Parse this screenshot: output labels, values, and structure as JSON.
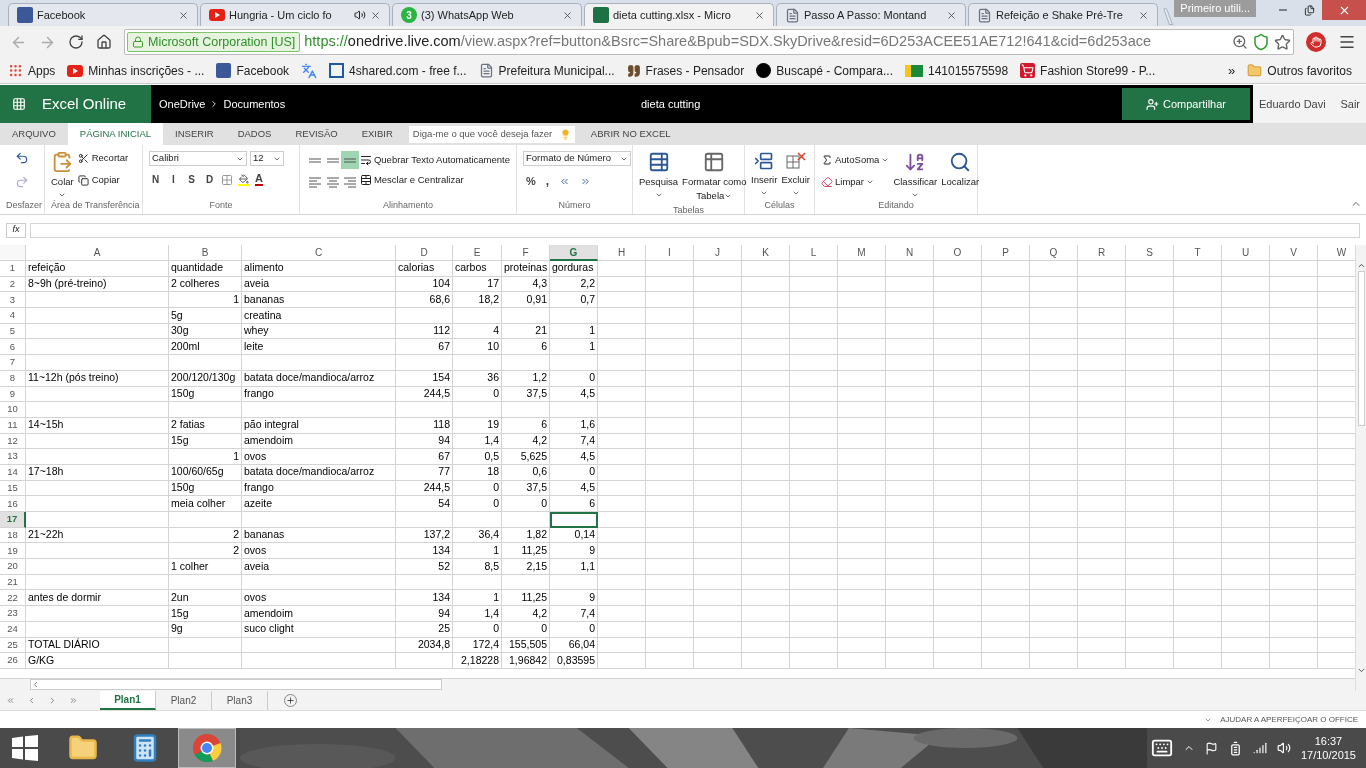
{
  "browser": {
    "tabs": [
      {
        "title": "Facebook",
        "kind": "facebook",
        "selected": false,
        "audio": false
      },
      {
        "title": "Hungria - Um ciclo fo",
        "kind": "youtube",
        "selected": false,
        "audio": true
      },
      {
        "title": "(3) WhatsApp Web",
        "kind": "whatsapp",
        "badge": "3",
        "selected": false,
        "audio": false
      },
      {
        "title": "dieta cutting.xlsx - Micro",
        "kind": "excel",
        "selected": true,
        "audio": false
      },
      {
        "title": "Passo A Passo: Montand",
        "kind": "page",
        "selected": false,
        "audio": false
      },
      {
        "title": "Refeição e Shake Pré-Tre",
        "kind": "page",
        "selected": false,
        "audio": false
      }
    ],
    "profile": "Primeiro utili...",
    "address": {
      "identity": "Microsoft Corporation [US]",
      "scheme": "https://",
      "host": "onedrive.live.com",
      "path": "/view.aspx?ref=button&Bsrc=Share&Bpub=SDX.SkyDrive&resid=6D253ACEE51AE712!641&cid=6d253ace"
    },
    "bookmarks": [
      {
        "title": "Apps",
        "kind": "apps"
      },
      {
        "title": "Minhas inscrições - ...",
        "kind": "youtube"
      },
      {
        "title": "Facebook",
        "kind": "facebook"
      },
      {
        "kind": "translate"
      },
      {
        "title": "4shared.com - free f...",
        "kind": "fourshared"
      },
      {
        "title": "Prefeitura Municipal...",
        "kind": "page"
      },
      {
        "title": "Frases - Pensador",
        "kind": "quote"
      },
      {
        "title": "Buscapé - Compara...",
        "kind": "buscape"
      },
      {
        "title": "141015575598",
        "kind": "flag"
      },
      {
        "title": "Fashion Store99 - P...",
        "kind": "cart"
      }
    ],
    "more": "»",
    "other_bookmarks": "Outros favoritos"
  },
  "excel": {
    "app_name": "Excel Online",
    "breadcrumb": [
      "OneDrive",
      "Documentos"
    ],
    "document_title": "dieta cutting",
    "share": "Compartilhar",
    "user": "Eduardo Davi",
    "sign_out": "Sair",
    "ribbon_tabs": [
      {
        "label": "ARQUIVO",
        "selected": false
      },
      {
        "label": "PÁGINA INICIAL",
        "selected": true
      },
      {
        "label": "INSERIR",
        "selected": false
      },
      {
        "label": "DADOS",
        "selected": false
      },
      {
        "label": "REVISÃO",
        "selected": false
      },
      {
        "label": "EXIBIR",
        "selected": false
      }
    ],
    "tell_me": {
      "placeholder": "Diga-me o que você deseja fazer"
    },
    "open_in_excel": "ABRIR NO EXCEL",
    "ribbon": {
      "undo_group": "Desfazer",
      "clipboard": {
        "label": "Área de Transferência",
        "paste": "Colar",
        "cut": "Recortar",
        "copy": "Copiar"
      },
      "font": {
        "label": "Fonte",
        "family": "Calibri",
        "size": "12",
        "styles": [
          "N",
          "I",
          "S",
          "D"
        ],
        "color_letter": "A"
      },
      "alignment": {
        "label": "Alinhamento",
        "buttons": [
          {
            "kind": "top",
            "selected": false
          },
          {
            "kind": "middle",
            "selected": false
          },
          {
            "kind": "bottom",
            "selected": true
          },
          {
            "kind": "left",
            "selected": false
          },
          {
            "kind": "center",
            "selected": false
          },
          {
            "kind": "right",
            "selected": false
          }
        ],
        "wrap": "Quebrar Texto Automaticamente",
        "merge": "Mesclar e Centralizar"
      },
      "number": {
        "label": "Número",
        "format": "Formato de Número",
        "percent": "%",
        "comma": ","
      },
      "tables": {
        "label": "Tabelas",
        "lookup": "Pesquisa",
        "format_table": "Formatar como",
        "format_table_2": "Tabela"
      },
      "cells": {
        "label": "Células",
        "insert": "Inserir",
        "delete": "Excluir"
      },
      "editing": {
        "label": "Editando",
        "autosum": "AutoSoma",
        "clear": "Limpar",
        "sort": "Classificar",
        "find": "Localizar"
      }
    },
    "formula_bar": {
      "label": "fx"
    },
    "columns": [
      {
        "letter": "A",
        "selected": false
      },
      {
        "letter": "B",
        "selected": false
      },
      {
        "letter": "C",
        "selected": false
      },
      {
        "letter": "D",
        "selected": false
      },
      {
        "letter": "E",
        "selected": false
      },
      {
        "letter": "F",
        "selected": false
      },
      {
        "letter": "G",
        "selected": true
      },
      {
        "letter": "H",
        "selected": false
      },
      {
        "letter": "I",
        "selected": false
      },
      {
        "letter": "J",
        "selected": false
      },
      {
        "letter": "K",
        "selected": false
      },
      {
        "letter": "L",
        "selected": false
      },
      {
        "letter": "M",
        "selected": false
      },
      {
        "letter": "N",
        "selected": false
      },
      {
        "letter": "O",
        "selected": false
      },
      {
        "letter": "P",
        "selected": false
      },
      {
        "letter": "Q",
        "selected": false
      },
      {
        "letter": "R",
        "selected": false
      },
      {
        "letter": "S",
        "selected": false
      },
      {
        "letter": "T",
        "selected": false
      },
      {
        "letter": "U",
        "selected": false
      },
      {
        "letter": "V",
        "selected": false
      },
      {
        "letter": "W",
        "selected": false
      }
    ],
    "rows": [
      {
        "number": "1",
        "selected": false,
        "cells": [
          {
            "text": "refeição",
            "kind": "text"
          },
          {
            "text": "quantidade",
            "kind": "text"
          },
          {
            "text": "alimento",
            "kind": "text"
          },
          {
            "text": "calorias",
            "kind": "text"
          },
          {
            "text": "carbos",
            "kind": "text"
          },
          {
            "text": "proteinas",
            "kind": "text"
          },
          {
            "text": "gorduras",
            "kind": "text"
          }
        ]
      },
      {
        "number": "2",
        "selected": false,
        "cells": [
          {
            "text": "8~9h (pré-treino)",
            "kind": "text"
          },
          {
            "text": "2 colheres",
            "kind": "text"
          },
          {
            "text": "aveia",
            "kind": "text"
          },
          {
            "text": "104",
            "kind": "number"
          },
          {
            "text": "17",
            "kind": "number"
          },
          {
            "text": "4,3",
            "kind": "number"
          },
          {
            "text": "2,2",
            "kind": "number"
          }
        ]
      },
      {
        "number": "3",
        "selected": false,
        "cells": [
          {
            "kind": "empty"
          },
          {
            "text": "1",
            "kind": "number"
          },
          {
            "text": "bananas",
            "kind": "text"
          },
          {
            "text": "68,6",
            "kind": "number"
          },
          {
            "text": "18,2",
            "kind": "number"
          },
          {
            "text": "0,91",
            "kind": "number"
          },
          {
            "text": "0,7",
            "kind": "number"
          }
        ]
      },
      {
        "number": "4",
        "selected": false,
        "cells": [
          {
            "kind": "empty"
          },
          {
            "text": "5g",
            "kind": "text"
          },
          {
            "text": "creatina",
            "kind": "text"
          }
        ]
      },
      {
        "number": "5",
        "selected": false,
        "cells": [
          {
            "kind": "empty"
          },
          {
            "text": "30g",
            "kind": "text"
          },
          {
            "text": "whey",
            "kind": "text"
          },
          {
            "text": "112",
            "kind": "number"
          },
          {
            "text": "4",
            "kind": "number"
          },
          {
            "text": "21",
            "kind": "number"
          },
          {
            "text": "1",
            "kind": "number"
          }
        ]
      },
      {
        "number": "6",
        "selected": false,
        "cells": [
          {
            "kind": "empty"
          },
          {
            "text": "200ml",
            "kind": "text"
          },
          {
            "text": "leite",
            "kind": "text"
          },
          {
            "text": "67",
            "kind": "number"
          },
          {
            "text": "10",
            "kind": "number"
          },
          {
            "text": "6",
            "kind": "number"
          },
          {
            "text": "1",
            "kind": "number"
          }
        ]
      },
      {
        "number": "7",
        "selected": false,
        "cells": []
      },
      {
        "number": "8",
        "selected": false,
        "cells": [
          {
            "text": "11~12h (pós treino)",
            "kind": "text"
          },
          {
            "text": "200/120/130g",
            "kind": "text"
          },
          {
            "text": "batata doce/mandioca/arroz",
            "kind": "text"
          },
          {
            "text": "154",
            "kind": "number"
          },
          {
            "text": "36",
            "kind": "number"
          },
          {
            "text": "1,2",
            "kind": "number"
          },
          {
            "text": "0",
            "kind": "number"
          }
        ]
      },
      {
        "number": "9",
        "selected": false,
        "cells": [
          {
            "kind": "empty"
          },
          {
            "text": "150g",
            "kind": "text"
          },
          {
            "text": "frango",
            "kind": "text"
          },
          {
            "text": "244,5",
            "kind": "number"
          },
          {
            "text": "0",
            "kind": "number"
          },
          {
            "text": "37,5",
            "kind": "number"
          },
          {
            "text": "4,5",
            "kind": "number"
          }
        ]
      },
      {
        "number": "10",
        "selected": false,
        "cells": []
      },
      {
        "number": "11",
        "selected": false,
        "cells": [
          {
            "text": "14~15h",
            "kind": "text"
          },
          {
            "text": "2 fatias",
            "kind": "text"
          },
          {
            "text": "pão integral",
            "kind": "text"
          },
          {
            "text": "118",
            "kind": "number"
          },
          {
            "text": "19",
            "kind": "number"
          },
          {
            "text": "6",
            "kind": "number"
          },
          {
            "text": "1,6",
            "kind": "number"
          }
        ]
      },
      {
        "number": "12",
        "selected": false,
        "cells": [
          {
            "kind": "empty"
          },
          {
            "text": "15g",
            "kind": "text"
          },
          {
            "text": "amendoim",
            "kind": "text"
          },
          {
            "text": "94",
            "kind": "number"
          },
          {
            "text": "1,4",
            "kind": "number"
          },
          {
            "text": "4,2",
            "kind": "number"
          },
          {
            "text": "7,4",
            "kind": "number"
          }
        ]
      },
      {
        "number": "13",
        "selected": false,
        "cells": [
          {
            "kind": "empty"
          },
          {
            "text": "1",
            "kind": "number"
          },
          {
            "text": "ovos",
            "kind": "text"
          },
          {
            "text": "67",
            "kind": "number"
          },
          {
            "text": "0,5",
            "kind": "number"
          },
          {
            "text": "5,625",
            "kind": "number"
          },
          {
            "text": "4,5",
            "kind": "number"
          }
        ]
      },
      {
        "number": "14",
        "selected": false,
        "cells": [
          {
            "text": "17~18h",
            "kind": "text"
          },
          {
            "text": "100/60/65g",
            "kind": "text"
          },
          {
            "text": "batata doce/mandioca/arroz",
            "kind": "text"
          },
          {
            "text": "77",
            "kind": "number"
          },
          {
            "text": "18",
            "kind": "number"
          },
          {
            "text": "0,6",
            "kind": "number"
          },
          {
            "text": "0",
            "kind": "number"
          }
        ]
      },
      {
        "number": "15",
        "selected": false,
        "cells": [
          {
            "kind": "empty"
          },
          {
            "text": "150g",
            "kind": "text"
          },
          {
            "text": "frango",
            "kind": "text"
          },
          {
            "text": "244,5",
            "kind": "number"
          },
          {
            "text": "0",
            "kind": "number"
          },
          {
            "text": "37,5",
            "kind": "number"
          },
          {
            "text": "4,5",
            "kind": "number"
          }
        ]
      },
      {
        "number": "16",
        "selected": false,
        "cells": [
          {
            "kind": "empty"
          },
          {
            "text": "meia colher",
            "kind": "text"
          },
          {
            "text": "azeite",
            "kind": "text"
          },
          {
            "text": "54",
            "kind": "number"
          },
          {
            "text": "0",
            "kind": "number"
          },
          {
            "text": "0",
            "kind": "number"
          },
          {
            "text": "6",
            "kind": "number"
          }
        ]
      },
      {
        "number": "17",
        "selected": true,
        "cells": []
      },
      {
        "number": "18",
        "selected": false,
        "cells": [
          {
            "text": "21~22h",
            "kind": "text"
          },
          {
            "text": "2",
            "kind": "number"
          },
          {
            "text": "bananas",
            "kind": "text"
          },
          {
            "text": "137,2",
            "kind": "number"
          },
          {
            "text": "36,4",
            "kind": "number"
          },
          {
            "text": "1,82",
            "kind": "number"
          },
          {
            "text": "0,14",
            "kind": "number"
          }
        ]
      },
      {
        "number": "19",
        "selected": false,
        "cells": [
          {
            "kind": "empty"
          },
          {
            "text": "2",
            "kind": "number"
          },
          {
            "text": "ovos",
            "kind": "text"
          },
          {
            "text": "134",
            "kind": "number"
          },
          {
            "text": "1",
            "kind": "number"
          },
          {
            "text": "11,25",
            "kind": "number"
          },
          {
            "text": "9",
            "kind": "number"
          }
        ]
      },
      {
        "number": "20",
        "selected": false,
        "cells": [
          {
            "kind": "empty"
          },
          {
            "text": "1 colher",
            "kind": "text"
          },
          {
            "text": "aveia",
            "kind": "text"
          },
          {
            "text": "52",
            "kind": "number"
          },
          {
            "text": "8,5",
            "kind": "number"
          },
          {
            "text": "2,15",
            "kind": "number"
          },
          {
            "text": "1,1",
            "kind": "number"
          }
        ]
      },
      {
        "number": "21",
        "selected": false,
        "cells": []
      },
      {
        "number": "22",
        "selected": false,
        "cells": [
          {
            "text": "antes de dormir",
            "kind": "text"
          },
          {
            "text": "2un",
            "kind": "text"
          },
          {
            "text": "ovos",
            "kind": "text"
          },
          {
            "text": "134",
            "kind": "number"
          },
          {
            "text": "1",
            "kind": "number"
          },
          {
            "text": "11,25",
            "kind": "number"
          },
          {
            "text": "9",
            "kind": "number"
          }
        ]
      },
      {
        "number": "23",
        "selected": false,
        "cells": [
          {
            "kind": "empty"
          },
          {
            "text": "15g",
            "kind": "text"
          },
          {
            "text": "amendoim",
            "kind": "text"
          },
          {
            "text": "94",
            "kind": "number"
          },
          {
            "text": "1,4",
            "kind": "number"
          },
          {
            "text": "4,2",
            "kind": "number"
          },
          {
            "text": "7,4",
            "kind": "number"
          }
        ]
      },
      {
        "number": "24",
        "selected": false,
        "cells": [
          {
            "kind": "empty"
          },
          {
            "text": "9g",
            "kind": "text"
          },
          {
            "text": "suco clight",
            "kind": "text"
          },
          {
            "text": "25",
            "kind": "number"
          },
          {
            "text": "0",
            "kind": "number"
          },
          {
            "text": "0",
            "kind": "number"
          },
          {
            "text": "0",
            "kind": "number"
          }
        ]
      },
      {
        "number": "25",
        "selected": false,
        "cells": [
          {
            "text": "TOTAL DIÁRIO",
            "kind": "text"
          },
          {
            "kind": "empty"
          },
          {
            "kind": "empty"
          },
          {
            "text": "2034,8",
            "kind": "number"
          },
          {
            "text": "172,4",
            "kind": "number"
          },
          {
            "text": "155,505",
            "kind": "number"
          },
          {
            "text": "66,04",
            "kind": "number"
          }
        ]
      },
      {
        "number": "26",
        "selected": false,
        "cells": [
          {
            "text": "G/KG",
            "kind": "text"
          },
          {
            "kind": "empty"
          },
          {
            "kind": "empty"
          },
          {
            "kind": "empty"
          },
          {
            "text": "2,18228",
            "kind": "number"
          },
          {
            "text": "1,96842",
            "kind": "number"
          },
          {
            "text": "0,83595",
            "kind": "number"
          }
        ]
      }
    ],
    "sheet_tabs": [
      {
        "name": "Plan1",
        "selected": true
      },
      {
        "name": "Plan2",
        "selected": false
      },
      {
        "name": "Plan3",
        "selected": false
      }
    ],
    "status": "AJUDAR A APERFEIÇOAR O OFFICE"
  },
  "taskbar": {
    "apps": [
      {
        "kind": "explorer",
        "selected": false
      },
      {
        "kind": "calculator",
        "selected": false
      },
      {
        "kind": "chrome",
        "selected": true
      }
    ],
    "time": "16:37",
    "date": "17/10/2015"
  }
}
